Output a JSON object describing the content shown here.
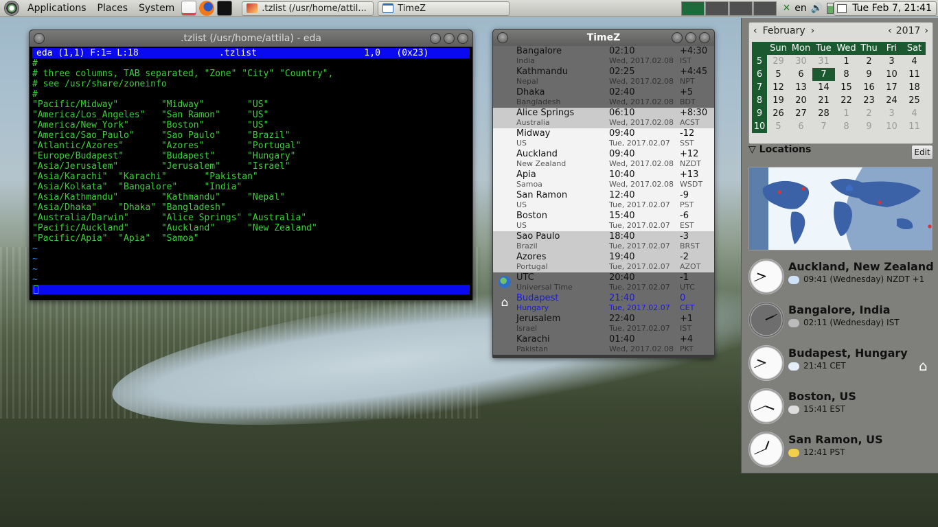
{
  "panel": {
    "menus": [
      "Applications",
      "Places",
      "System"
    ],
    "tasks": [
      {
        "label": ".tzlist (/usr/home/attil..."
      },
      {
        "label": "TimeZ"
      }
    ],
    "tray_lang": "en",
    "clock": "Tue Feb  7, 21:41"
  },
  "editor": {
    "title": ".tzlist (/usr/home/attila) - eda",
    "status": "eda (1,1) F:1= L:18               .tzlist                    1,0   (0x23)",
    "lines": [
      "#",
      "# three columns, TAB separated, \"Zone\" \"City\" \"Country\",",
      "# see /usr/share/zoneinfo",
      "#",
      "\"Pacific/Midway\"        \"Midway\"        \"US\"",
      "\"America/Los_Angeles\"   \"San Ramon\"     \"US\"",
      "\"America/New_York\"      \"Boston\"        \"US\"",
      "\"America/Sao_Paulo\"     \"Sao Paulo\"     \"Brazil\"",
      "\"Atlantic/Azores\"       \"Azores\"        \"Portugal\"",
      "\"Europe/Budapest\"       \"Budapest\"      \"Hungary\"",
      "\"Asia/Jerusalem\"        \"Jerusalem\"     \"Israel\"",
      "\"Asia/Karachi\"  \"Karachi\"       \"Pakistan\"",
      "\"Asia/Kolkata\"  \"Bangalore\"     \"India\"",
      "\"Asia/Kathmandu\"        \"Kathmandu\"     \"Nepal\"",
      "\"Asia/Dhaka\"    \"Dhaka\" \"Bangladesh\"",
      "\"Australia/Darwin\"      \"Alice Springs\" \"Australia\"",
      "\"Pacific/Auckland\"      \"Auckland\"      \"New Zealand\"",
      "\"Pacific/Apia\"  \"Apia\"  \"Samoa\"",
      "~",
      "~",
      "~",
      "~"
    ]
  },
  "timez": {
    "title": "TimeZ",
    "rows": [
      {
        "city": "Bangalore",
        "country": "India",
        "time": "02:10",
        "date": "Wed, 2017.02.08",
        "offset": "+4:30",
        "abbr": "IST",
        "shade": "dark"
      },
      {
        "city": "Kathmandu",
        "country": "Nepal",
        "time": "02:25",
        "date": "Wed, 2017.02.08",
        "offset": "+4:45",
        "abbr": "NPT",
        "shade": "dark"
      },
      {
        "city": "Dhaka",
        "country": "Bangladesh",
        "time": "02:40",
        "date": "Wed, 2017.02.08",
        "offset": "+5",
        "abbr": "BDT",
        "shade": "dark"
      },
      {
        "city": "Alice Springs",
        "country": "Australia",
        "time": "06:10",
        "date": "Wed, 2017.02.08",
        "offset": "+8:30",
        "abbr": "ACST",
        "shade": "light"
      },
      {
        "city": "Midway",
        "country": "US",
        "time": "09:40",
        "date": "Tue, 2017.02.07",
        "offset": "-12",
        "abbr": "SST",
        "shade": "white"
      },
      {
        "city": "Auckland",
        "country": "New Zealand",
        "time": "09:40",
        "date": "Wed, 2017.02.08",
        "offset": "+12",
        "abbr": "NZDT",
        "shade": "white"
      },
      {
        "city": "Apia",
        "country": "Samoa",
        "time": "10:40",
        "date": "Wed, 2017.02.08",
        "offset": "+13",
        "abbr": "WSDT",
        "shade": "white"
      },
      {
        "city": "San Ramon",
        "country": "US",
        "time": "12:40",
        "date": "Tue, 2017.02.07",
        "offset": "-9",
        "abbr": "PST",
        "shade": "white"
      },
      {
        "city": "Boston",
        "country": "US",
        "time": "15:40",
        "date": "Tue, 2017.02.07",
        "offset": "-6",
        "abbr": "EST",
        "shade": "white"
      },
      {
        "city": "Sao Paulo",
        "country": "Brazil",
        "time": "18:40",
        "date": "Tue, 2017.02.07",
        "offset": "-3",
        "abbr": "BRST",
        "shade": "light"
      },
      {
        "city": "Azores",
        "country": "Portugal",
        "time": "19:40",
        "date": "Tue, 2017.02.07",
        "offset": "-2",
        "abbr": "AZOT",
        "shade": "light"
      },
      {
        "city": "UTC",
        "country": "Universal Time",
        "time": "20:40",
        "date": "Tue, 2017.02.07",
        "offset": "-1",
        "abbr": "UTC",
        "shade": "dark",
        "icon": "globe-icon"
      },
      {
        "city": "Budapest",
        "country": "Hungary",
        "time": "21:40",
        "date": "Tue, 2017.02.07",
        "offset": "0",
        "abbr": "CET",
        "shade": "dark",
        "icon": "home-icon",
        "home": true
      },
      {
        "city": "Jerusalem",
        "country": "Israel",
        "time": "22:40",
        "date": "Tue, 2017.02.07",
        "offset": "+1",
        "abbr": "IST",
        "shade": "dark"
      },
      {
        "city": "Karachi",
        "country": "Pakistan",
        "time": "01:40",
        "date": "Wed, 2017.02.08",
        "offset": "+4",
        "abbr": "PKT",
        "shade": "dark"
      }
    ]
  },
  "calendar": {
    "month": "February",
    "year": "2017",
    "weekdays": [
      "Sun",
      "Mon",
      "Tue",
      "Wed",
      "Thu",
      "Fri",
      "Sat"
    ],
    "weeks": [
      {
        "wk": "5",
        "days": [
          [
            "29",
            "dim"
          ],
          [
            "30",
            "dim"
          ],
          [
            "31",
            "dim"
          ],
          [
            "1",
            ""
          ],
          [
            "2",
            ""
          ],
          [
            "3",
            ""
          ],
          [
            "4",
            ""
          ]
        ]
      },
      {
        "wk": "6",
        "days": [
          [
            "5",
            ""
          ],
          [
            "6",
            ""
          ],
          [
            "7",
            "today"
          ],
          [
            "8",
            ""
          ],
          [
            "9",
            ""
          ],
          [
            "10",
            ""
          ],
          [
            "11",
            ""
          ]
        ]
      },
      {
        "wk": "7",
        "days": [
          [
            "12",
            ""
          ],
          [
            "13",
            ""
          ],
          [
            "14",
            ""
          ],
          [
            "15",
            ""
          ],
          [
            "16",
            ""
          ],
          [
            "17",
            ""
          ],
          [
            "18",
            ""
          ]
        ]
      },
      {
        "wk": "8",
        "days": [
          [
            "19",
            ""
          ],
          [
            "20",
            ""
          ],
          [
            "21",
            ""
          ],
          [
            "22",
            ""
          ],
          [
            "23",
            ""
          ],
          [
            "24",
            ""
          ],
          [
            "25",
            ""
          ]
        ]
      },
      {
        "wk": "9",
        "days": [
          [
            "26",
            ""
          ],
          [
            "27",
            ""
          ],
          [
            "28",
            ""
          ],
          [
            "1",
            "dim"
          ],
          [
            "2",
            "dim"
          ],
          [
            "3",
            "dim"
          ],
          [
            "4",
            "dim"
          ]
        ]
      },
      {
        "wk": "10",
        "days": [
          [
            "5",
            "dim"
          ],
          [
            "6",
            "dim"
          ],
          [
            "7",
            "dim"
          ],
          [
            "8",
            "dim"
          ],
          [
            "9",
            "dim"
          ],
          [
            "10",
            "dim"
          ],
          [
            "11",
            "dim"
          ]
        ]
      }
    ]
  },
  "locations": {
    "header": "Locations",
    "edit_label": "Edit",
    "items": [
      {
        "name": "Auckland, New Zealand",
        "desc": "09:41 (Wednesday) NZDT +1",
        "weather_icon": "cloud-sun-icon",
        "night": false,
        "hour": 9,
        "minute": 41
      },
      {
        "name": "Bangalore, India",
        "desc": "02:11 (Wednesday) IST",
        "weather_icon": "moon-icon",
        "night": true,
        "hour": 2,
        "minute": 11
      },
      {
        "name": "Budapest, Hungary",
        "desc": "21:41 CET",
        "weather_icon": "cloud-icon",
        "night": false,
        "hour": 21,
        "minute": 41,
        "home": true
      },
      {
        "name": "Boston, US",
        "desc": "15:41 EST",
        "weather_icon": "fog-icon",
        "night": false,
        "hour": 15,
        "minute": 41
      },
      {
        "name": "San Ramon, US",
        "desc": "12:41 PST",
        "weather_icon": "sun-cloud-icon",
        "night": false,
        "hour": 12,
        "minute": 41
      }
    ]
  },
  "colors": {
    "accent": "#1b5a30",
    "editor_text": "#3ad13a",
    "status_bar": "#0a0af0"
  }
}
